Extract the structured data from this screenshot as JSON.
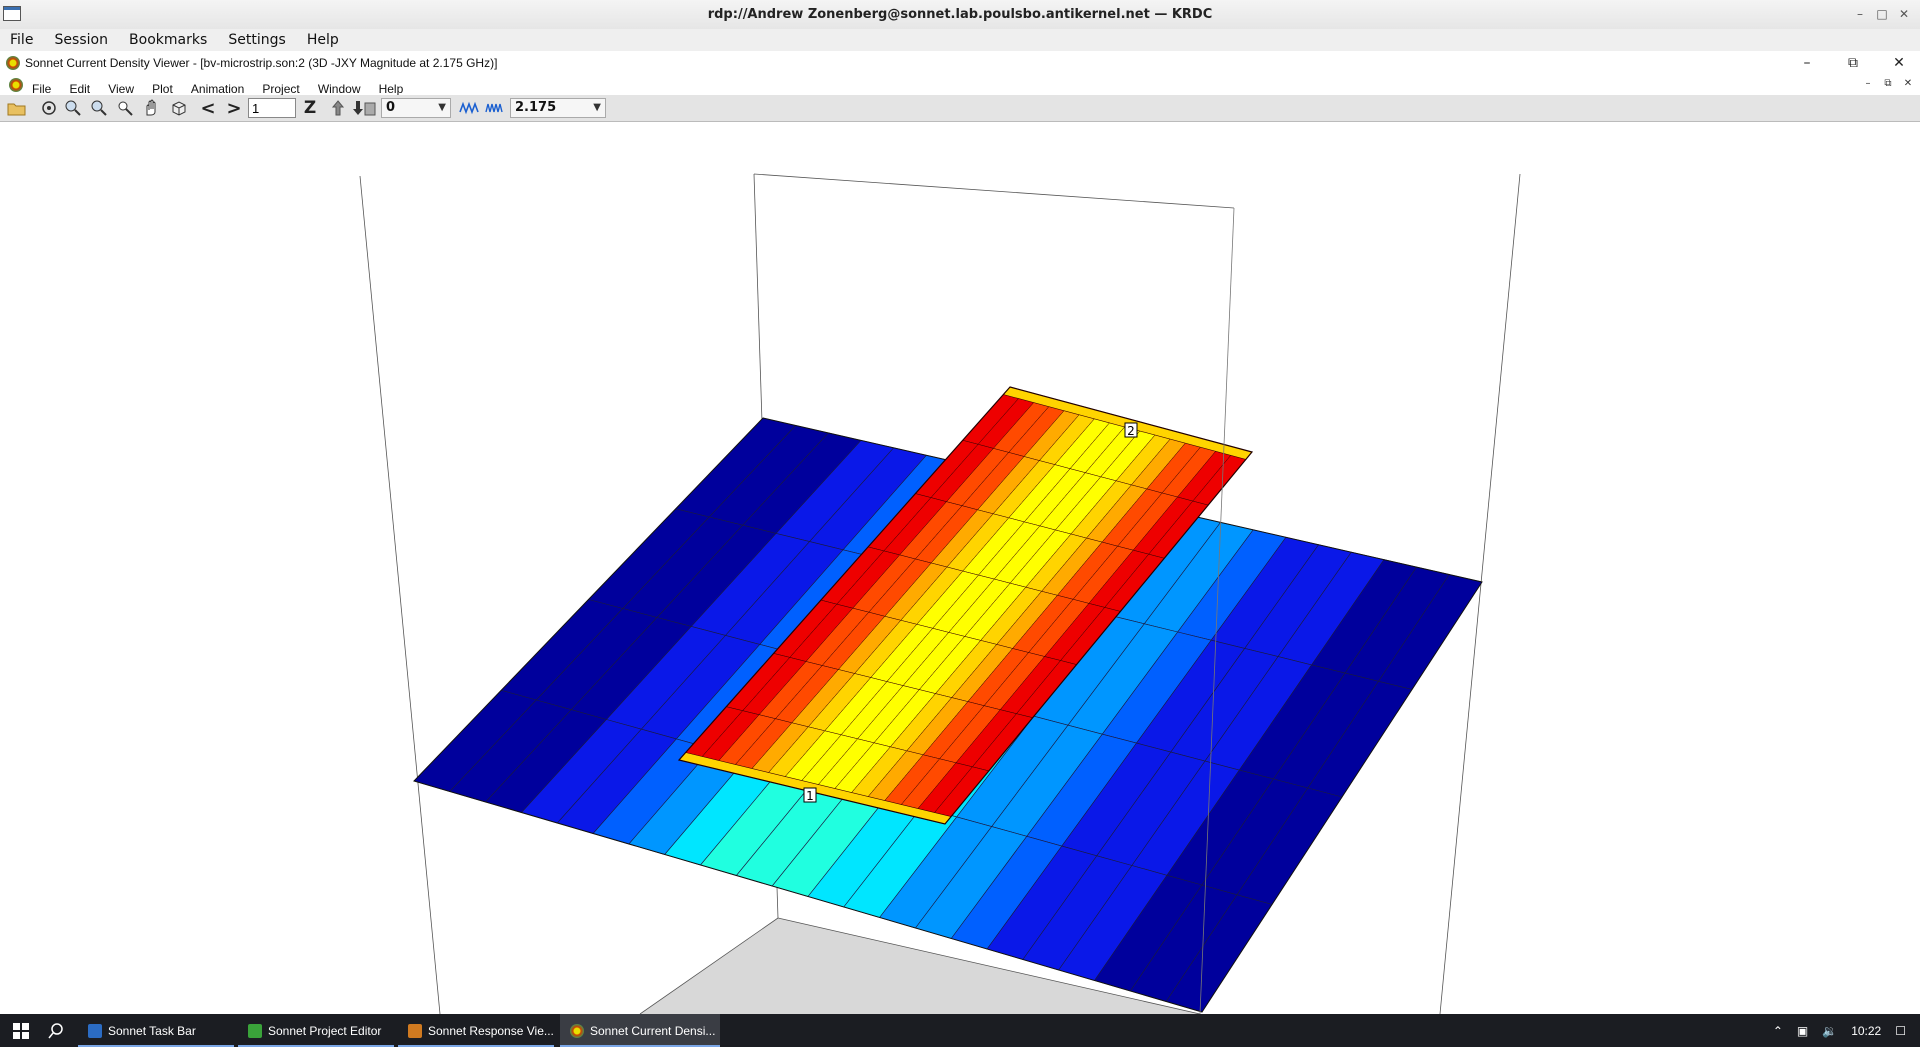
{
  "krdc": {
    "title": "rdp://Andrew Zonenberg@sonnet.lab.poulsbo.antikernel.net — KRDC",
    "menu": [
      "File",
      "Session",
      "Bookmarks",
      "Settings",
      "Help"
    ],
    "controls": {
      "minimize": "–",
      "restore": "□",
      "close": "✕"
    }
  },
  "app": {
    "title": "Sonnet Current Density Viewer - [bv-microstrip.son:2 (3D -JXY Magnitude at 2.175 GHz)]",
    "menu": [
      "File",
      "Edit",
      "View",
      "Plot",
      "Animation",
      "Project",
      "Window",
      "Help"
    ],
    "controls": {
      "minimize": "–",
      "restore": "⧉",
      "close": "✕"
    },
    "mdi_controls": {
      "minimize": "–",
      "restore": "⧉",
      "close": "✕"
    },
    "toolbar": {
      "prev": "<",
      "next": ">",
      "level_value": "1",
      "z_label": "Z",
      "combo_value": "0",
      "freq_value": "2.175"
    }
  },
  "plot": {
    "port_labels": [
      "1",
      "2"
    ],
    "colors": {
      "dark_blue": "#00009c",
      "blue": "#0a18e8",
      "mid_blue": "#0060ff",
      "light_blue": "#0096ff",
      "cyan": "#00e6ff",
      "aqua": "#20ffe0",
      "red": "#ee0000",
      "orange_red": "#ff4a00",
      "orange": "#ffaa00",
      "gold": "#ffd400",
      "yellow": "#ffff00"
    }
  },
  "taskbar": {
    "items": [
      {
        "label": "Sonnet Task Bar",
        "active": false
      },
      {
        "label": "Sonnet Project Editor",
        "active": false
      },
      {
        "label": "Sonnet Response Vie...",
        "active": false
      },
      {
        "label": "Sonnet Current Densi...",
        "active": true
      }
    ],
    "clock": "10:22"
  }
}
